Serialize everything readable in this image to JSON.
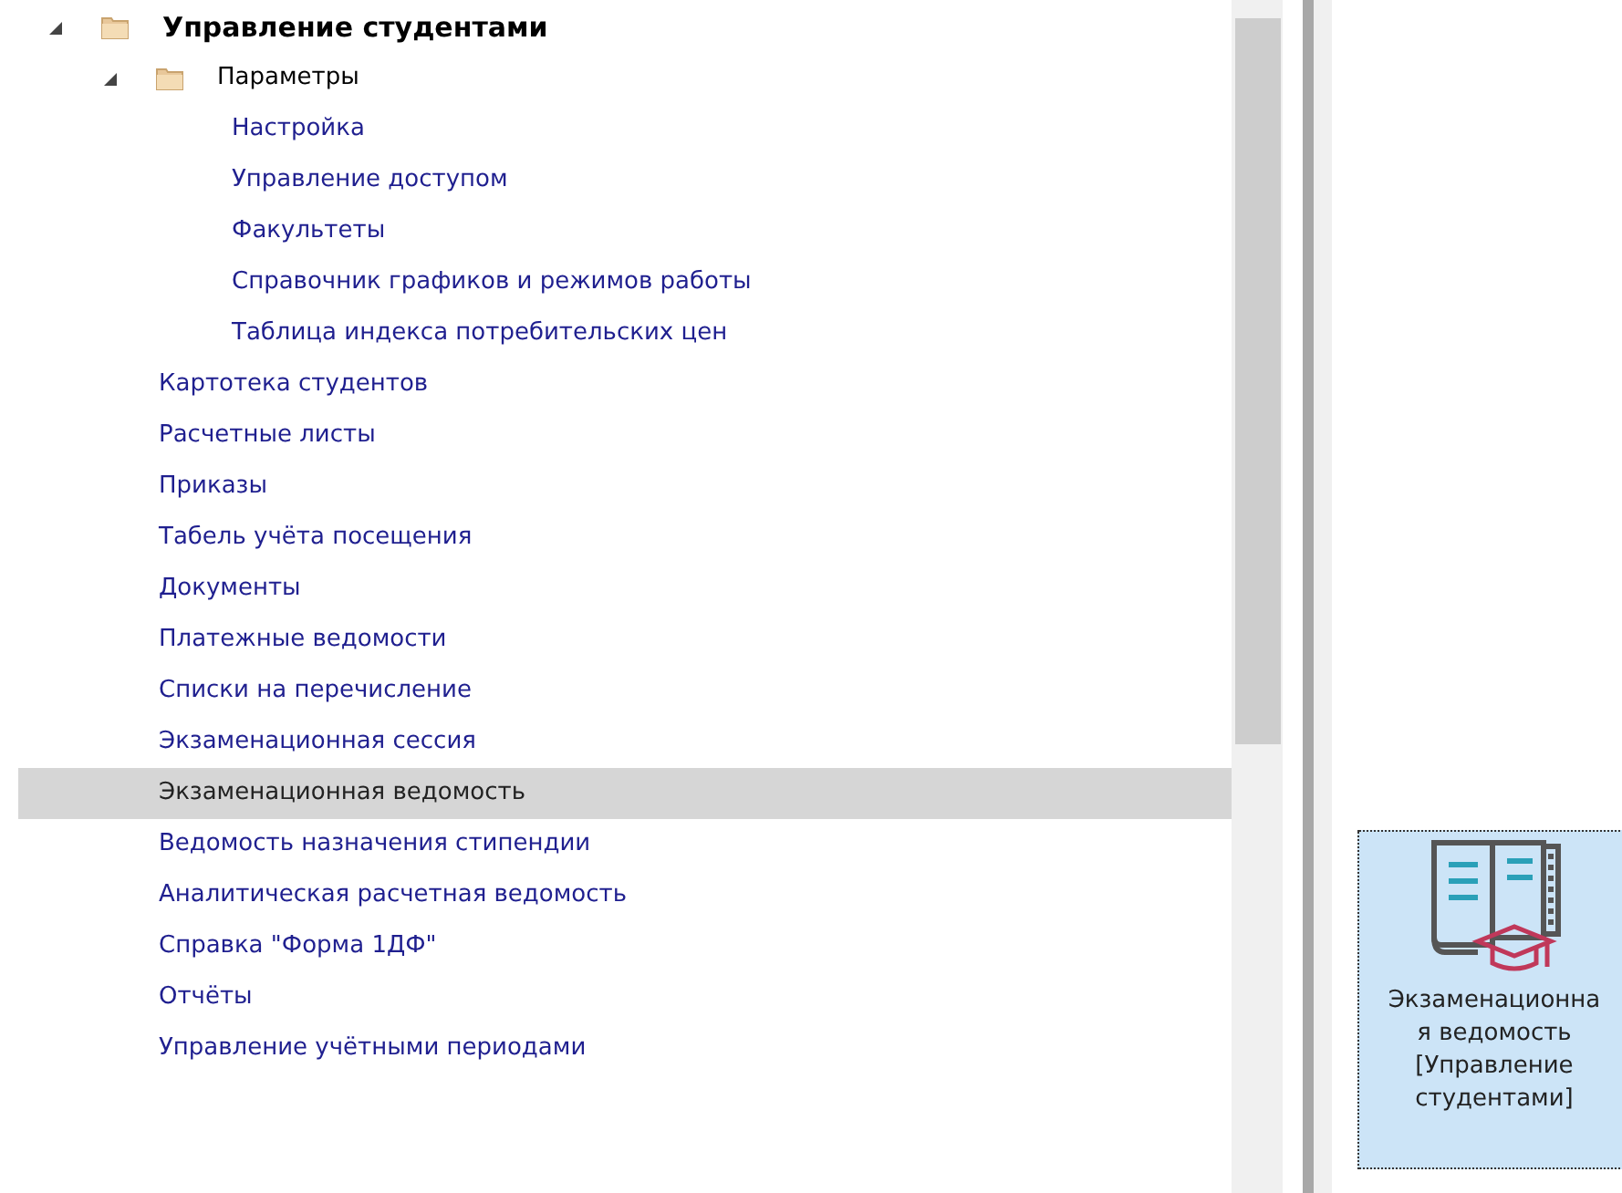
{
  "tree": [
    {
      "label": "Управление студентами",
      "kind": "folder",
      "expanded": true,
      "selected": false,
      "children": [
        {
          "label": "Параметры",
          "kind": "folder",
          "expanded": true,
          "selected": false,
          "children": [
            {
              "label": "Настройка",
              "kind": "leaf",
              "selected": false
            },
            {
              "label": "Управление доступом",
              "kind": "leaf",
              "selected": false
            },
            {
              "label": "Факультеты",
              "kind": "leaf",
              "selected": false
            },
            {
              "label": "Справочник графиков и режимов работы",
              "kind": "leaf",
              "selected": false
            },
            {
              "label": "Таблица индекса потребительских цен",
              "kind": "leaf",
              "selected": false
            }
          ]
        },
        {
          "label": "Картотека студентов",
          "kind": "leaf",
          "selected": false
        },
        {
          "label": "Расчетные листы",
          "kind": "leaf",
          "selected": false
        },
        {
          "label": "Приказы",
          "kind": "leaf",
          "selected": false
        },
        {
          "label": "Табель учёта посещения",
          "kind": "leaf",
          "selected": false
        },
        {
          "label": "Документы",
          "kind": "leaf",
          "selected": false
        },
        {
          "label": "Платежные ведомости",
          "kind": "leaf",
          "selected": false
        },
        {
          "label": "Списки на перечисление",
          "kind": "leaf",
          "selected": false
        },
        {
          "label": "Экзаменационная сессия",
          "kind": "leaf",
          "selected": false
        },
        {
          "label": "Экзаменационная ведомость",
          "kind": "leaf",
          "selected": true
        },
        {
          "label": "Ведомость назначения стипендии",
          "kind": "leaf",
          "selected": false
        },
        {
          "label": "Аналитическая расчетная ведомость",
          "kind": "leaf",
          "selected": false
        },
        {
          "label": "Справка \"Форма 1ДФ\"",
          "kind": "leaf",
          "selected": false
        },
        {
          "label": "Отчёты",
          "kind": "leaf",
          "selected": false
        },
        {
          "label": "Управление учётными периодами",
          "kind": "leaf",
          "selected": false
        }
      ]
    }
  ],
  "shortcut": {
    "lines": [
      "Экзаменационна",
      "я ведомость",
      "[Управление",
      "студентами]"
    ]
  }
}
